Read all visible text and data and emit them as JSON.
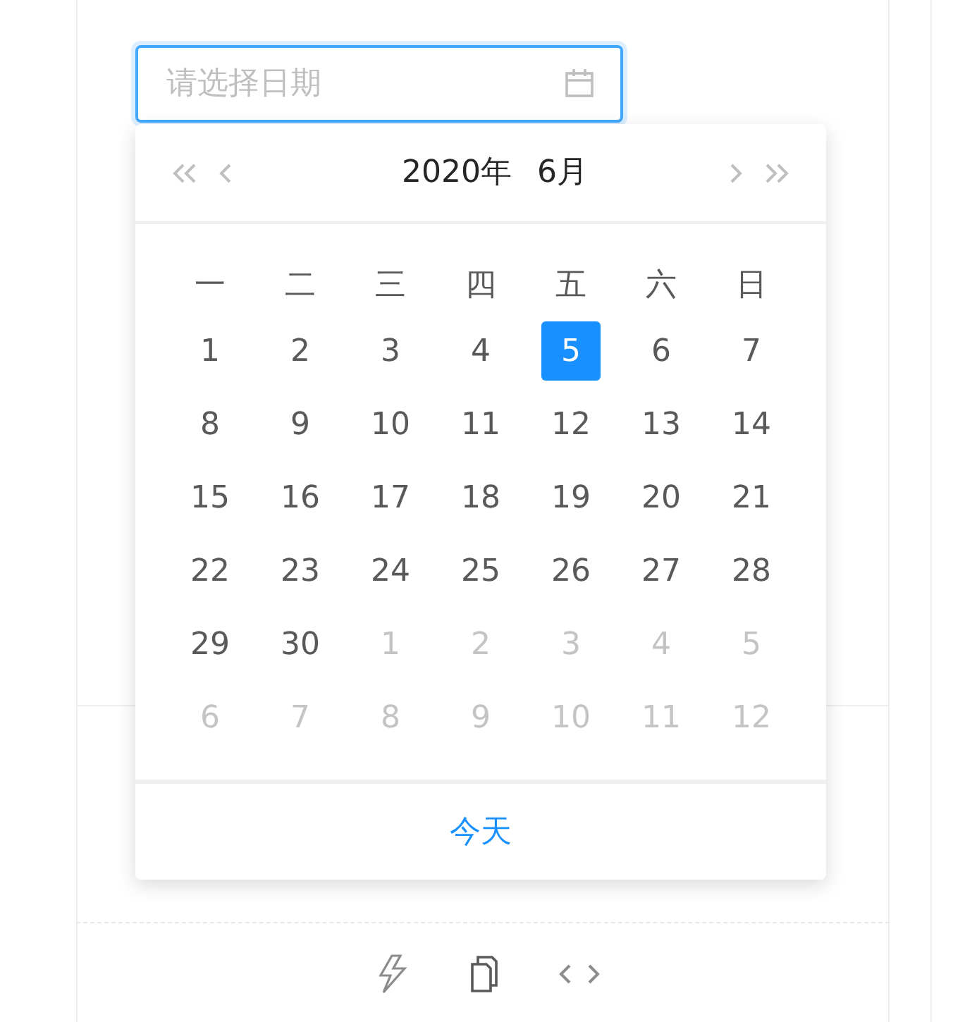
{
  "date_field": {
    "placeholder": "请选择日期"
  },
  "calendar": {
    "year": "2020年",
    "month": "6月",
    "weekdays": [
      "一",
      "二",
      "三",
      "四",
      "五",
      "六",
      "日"
    ],
    "weeks": [
      [
        {
          "text": "1",
          "in_month": true,
          "selected": false
        },
        {
          "text": "2",
          "in_month": true,
          "selected": false
        },
        {
          "text": "3",
          "in_month": true,
          "selected": false
        },
        {
          "text": "4",
          "in_month": true,
          "selected": false
        },
        {
          "text": "5",
          "in_month": true,
          "selected": true
        },
        {
          "text": "6",
          "in_month": true,
          "selected": false
        },
        {
          "text": "7",
          "in_month": true,
          "selected": false
        }
      ],
      [
        {
          "text": "8",
          "in_month": true,
          "selected": false
        },
        {
          "text": "9",
          "in_month": true,
          "selected": false
        },
        {
          "text": "10",
          "in_month": true,
          "selected": false
        },
        {
          "text": "11",
          "in_month": true,
          "selected": false
        },
        {
          "text": "12",
          "in_month": true,
          "selected": false
        },
        {
          "text": "13",
          "in_month": true,
          "selected": false
        },
        {
          "text": "14",
          "in_month": true,
          "selected": false
        }
      ],
      [
        {
          "text": "15",
          "in_month": true,
          "selected": false
        },
        {
          "text": "16",
          "in_month": true,
          "selected": false
        },
        {
          "text": "17",
          "in_month": true,
          "selected": false
        },
        {
          "text": "18",
          "in_month": true,
          "selected": false
        },
        {
          "text": "19",
          "in_month": true,
          "selected": false
        },
        {
          "text": "20",
          "in_month": true,
          "selected": false
        },
        {
          "text": "21",
          "in_month": true,
          "selected": false
        }
      ],
      [
        {
          "text": "22",
          "in_month": true,
          "selected": false
        },
        {
          "text": "23",
          "in_month": true,
          "selected": false
        },
        {
          "text": "24",
          "in_month": true,
          "selected": false
        },
        {
          "text": "25",
          "in_month": true,
          "selected": false
        },
        {
          "text": "26",
          "in_month": true,
          "selected": false
        },
        {
          "text": "27",
          "in_month": true,
          "selected": false
        },
        {
          "text": "28",
          "in_month": true,
          "selected": false
        }
      ],
      [
        {
          "text": "29",
          "in_month": true,
          "selected": false
        },
        {
          "text": "30",
          "in_month": true,
          "selected": false
        },
        {
          "text": "1",
          "in_month": false,
          "selected": false
        },
        {
          "text": "2",
          "in_month": false,
          "selected": false
        },
        {
          "text": "3",
          "in_month": false,
          "selected": false
        },
        {
          "text": "4",
          "in_month": false,
          "selected": false
        },
        {
          "text": "5",
          "in_month": false,
          "selected": false
        }
      ],
      [
        {
          "text": "6",
          "in_month": false,
          "selected": false
        },
        {
          "text": "7",
          "in_month": false,
          "selected": false
        },
        {
          "text": "8",
          "in_month": false,
          "selected": false
        },
        {
          "text": "9",
          "in_month": false,
          "selected": false
        },
        {
          "text": "10",
          "in_month": false,
          "selected": false
        },
        {
          "text": "11",
          "in_month": false,
          "selected": false
        },
        {
          "text": "12",
          "in_month": false,
          "selected": false
        }
      ]
    ],
    "today_link": "今天"
  }
}
